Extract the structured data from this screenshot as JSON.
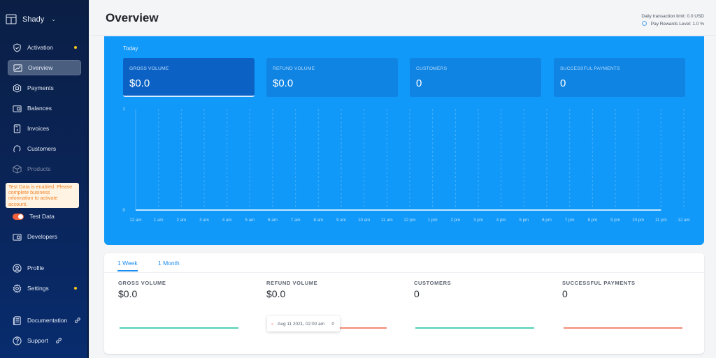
{
  "sidebar": {
    "account_name": "Shady",
    "items": [
      {
        "label": "Activation",
        "icon": "shield-check-icon",
        "badge": true
      },
      {
        "label": "Overview",
        "icon": "chart-line-icon",
        "active": true
      },
      {
        "label": "Payments",
        "icon": "payments-icon"
      },
      {
        "label": "Balances",
        "icon": "wallet-icon"
      },
      {
        "label": "Invoices",
        "icon": "invoice-icon"
      },
      {
        "label": "Customers",
        "icon": "customer-icon"
      },
      {
        "label": "Products",
        "icon": "box-icon",
        "disabled": true
      }
    ],
    "notice": "Test Data is enabled. Please complete business information to activate account.",
    "test_data_label": "Test Data",
    "test_data_enabled": true,
    "developers_label": "Developers",
    "profile_label": "Profile",
    "settings_label": "Settings",
    "documentation_label": "Documentation",
    "support_label": "Support"
  },
  "header": {
    "title": "Overview",
    "daily_limit": "Daily transaction limit: 0.0 USD",
    "rewards_level": "Pay Rewards Level: 1.0 %"
  },
  "today": {
    "label": "Today",
    "cards": [
      {
        "label": "GROSS VOLUME",
        "value": "$0.0",
        "active": true
      },
      {
        "label": "REFUND VOLUME",
        "value": "$0.0"
      },
      {
        "label": "CUSTOMERS",
        "value": "0"
      },
      {
        "label": "SUCCESSFUL PAYMENTS",
        "value": "0"
      }
    ]
  },
  "chart_data": {
    "type": "line",
    "title": "",
    "xlabel": "",
    "ylabel": "",
    "x": [
      "12 am",
      "1 am",
      "2 am",
      "3 am",
      "4 am",
      "5 am",
      "6 am",
      "7 am",
      "8 am",
      "9 am",
      "10 am",
      "11 am",
      "12 pm",
      "1 pm",
      "2 pm",
      "3 pm",
      "4 pm",
      "5 pm",
      "6 pm",
      "7 pm",
      "8 pm",
      "9 pm",
      "10 pm",
      "11 pm",
      "12 am"
    ],
    "series": [
      {
        "name": "Gross Volume",
        "values": [
          0,
          0,
          0,
          0,
          0,
          0,
          0,
          0,
          0,
          0,
          0,
          0,
          0,
          0,
          0,
          0,
          0,
          0,
          0,
          0,
          0,
          0,
          0,
          0
        ]
      }
    ],
    "y_ticks": [
      "0",
      "1"
    ],
    "ylim": [
      0,
      1
    ],
    "grid": true
  },
  "period": {
    "tabs": [
      {
        "label": "1 Week",
        "active": true
      },
      {
        "label": "1 Month"
      }
    ],
    "metrics": [
      {
        "label": "GROSS VOLUME",
        "value": "$0.0",
        "color": "#4fd1b5"
      },
      {
        "label": "REFUND VOLUME",
        "value": "$0.0",
        "color": "#f38b74"
      },
      {
        "label": "CUSTOMERS",
        "value": "0",
        "color": "#4fd1b5"
      },
      {
        "label": "SUCCESSFUL PAYMENTS",
        "value": "0",
        "color": "#f38b74"
      }
    ],
    "tooltip": {
      "date": "Aug 11 2021, 02:00 am",
      "value": "0"
    }
  },
  "colors": {
    "accent": "#1199f9",
    "active_card": "#0c62c4",
    "badge": "#f5c518",
    "toggle": "#f2623c"
  }
}
